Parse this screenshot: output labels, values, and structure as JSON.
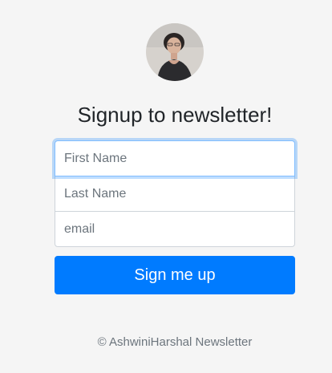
{
  "header": {
    "avatar_icon": "profile-photo",
    "title": "Signup to newsletter!"
  },
  "form": {
    "first_name": {
      "placeholder": "First Name",
      "value": ""
    },
    "last_name": {
      "placeholder": "Last Name",
      "value": ""
    },
    "email": {
      "placeholder": "email",
      "value": ""
    },
    "submit_label": "Sign me up"
  },
  "footer": {
    "text": "© AshwiniHarshal Newsletter"
  },
  "colors": {
    "background": "#f5f5f5",
    "primary": "#007bff",
    "focus_border": "#80bdff",
    "muted_text": "#6c757d"
  }
}
